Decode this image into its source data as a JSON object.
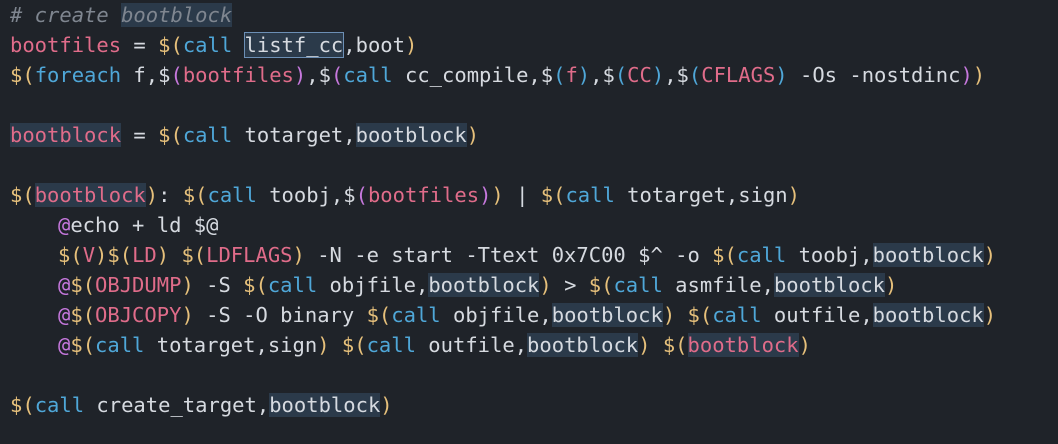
{
  "lines": [
    {
      "id": "l1",
      "tokens": [
        {
          "t": "# create ",
          "c": "comment"
        },
        {
          "t": "bootblock",
          "c": "comment hl"
        }
      ]
    },
    {
      "id": "l2",
      "tokens": [
        {
          "t": "bootfiles",
          "c": "var"
        },
        {
          "t": " = ",
          "c": "op"
        },
        {
          "t": "$",
          "c": "fn"
        },
        {
          "t": "(",
          "c": "fn"
        },
        {
          "t": "call",
          "c": "blue"
        },
        {
          "t": " ",
          "c": "plain"
        },
        {
          "t": "listf_cc",
          "c": "plain hl-sel"
        },
        {
          "t": ",boot",
          "c": "plain"
        },
        {
          "t": ")",
          "c": "fn"
        }
      ]
    },
    {
      "id": "l3",
      "tokens": [
        {
          "t": "$",
          "c": "fn"
        },
        {
          "t": "(",
          "c": "fn"
        },
        {
          "t": "foreach",
          "c": "blue"
        },
        {
          "t": " f,",
          "c": "plain"
        },
        {
          "t": "$",
          "c": "plain"
        },
        {
          "t": "(",
          "c": "purple"
        },
        {
          "t": "bootfiles",
          "c": "var"
        },
        {
          "t": ")",
          "c": "purple"
        },
        {
          "t": ",",
          "c": "plain"
        },
        {
          "t": "$",
          "c": "plain"
        },
        {
          "t": "(",
          "c": "purple"
        },
        {
          "t": "call",
          "c": "blue"
        },
        {
          "t": " cc_compile,",
          "c": "plain"
        },
        {
          "t": "$",
          "c": "plain"
        },
        {
          "t": "(",
          "c": "blue"
        },
        {
          "t": "f",
          "c": "var"
        },
        {
          "t": ")",
          "c": "blue"
        },
        {
          "t": ",",
          "c": "plain"
        },
        {
          "t": "$",
          "c": "plain"
        },
        {
          "t": "(",
          "c": "blue"
        },
        {
          "t": "CC",
          "c": "var"
        },
        {
          "t": ")",
          "c": "blue"
        },
        {
          "t": ",",
          "c": "plain"
        },
        {
          "t": "$",
          "c": "plain"
        },
        {
          "t": "(",
          "c": "blue"
        },
        {
          "t": "CFLAGS",
          "c": "var"
        },
        {
          "t": ")",
          "c": "blue"
        },
        {
          "t": " -Os -nostdinc",
          "c": "plain"
        },
        {
          "t": ")",
          "c": "purple"
        },
        {
          "t": ")",
          "c": "fn"
        }
      ]
    },
    {
      "id": "l4",
      "tokens": []
    },
    {
      "id": "l5",
      "tokens": [
        {
          "t": "bootblock",
          "c": "var hl"
        },
        {
          "t": " = ",
          "c": "op"
        },
        {
          "t": "$",
          "c": "fn"
        },
        {
          "t": "(",
          "c": "fn"
        },
        {
          "t": "call",
          "c": "blue"
        },
        {
          "t": " totarget,",
          "c": "plain"
        },
        {
          "t": "bootblock",
          "c": "plain hl"
        },
        {
          "t": ")",
          "c": "fn"
        }
      ]
    },
    {
      "id": "l6",
      "tokens": []
    },
    {
      "id": "l7",
      "tokens": [
        {
          "t": "$",
          "c": "fn"
        },
        {
          "t": "(",
          "c": "fn"
        },
        {
          "t": "bootblock",
          "c": "var hl"
        },
        {
          "t": ")",
          "c": "fn"
        },
        {
          "t": ": ",
          "c": "plain"
        },
        {
          "t": "$",
          "c": "fn"
        },
        {
          "t": "(",
          "c": "fn"
        },
        {
          "t": "call",
          "c": "blue"
        },
        {
          "t": " toobj,",
          "c": "plain"
        },
        {
          "t": "$",
          "c": "plain"
        },
        {
          "t": "(",
          "c": "purple"
        },
        {
          "t": "bootfiles",
          "c": "var"
        },
        {
          "t": ")",
          "c": "purple"
        },
        {
          "t": ")",
          "c": "fn"
        },
        {
          "t": " | ",
          "c": "plain"
        },
        {
          "t": "$",
          "c": "fn"
        },
        {
          "t": "(",
          "c": "fn"
        },
        {
          "t": "call",
          "c": "blue"
        },
        {
          "t": " totarget,sign",
          "c": "plain"
        },
        {
          "t": ")",
          "c": "fn"
        }
      ]
    },
    {
      "id": "l8",
      "indent": true,
      "tokens": [
        {
          "t": "@",
          "c": "purple"
        },
        {
          "t": "echo + ld $@",
          "c": "plain"
        }
      ]
    },
    {
      "id": "l9",
      "indent": true,
      "tokens": [
        {
          "t": "$",
          "c": "fn"
        },
        {
          "t": "(",
          "c": "fn"
        },
        {
          "t": "V",
          "c": "var"
        },
        {
          "t": ")",
          "c": "fn"
        },
        {
          "t": "$",
          "c": "fn"
        },
        {
          "t": "(",
          "c": "fn"
        },
        {
          "t": "LD",
          "c": "var"
        },
        {
          "t": ")",
          "c": "fn"
        },
        {
          "t": " ",
          "c": "plain"
        },
        {
          "t": "$",
          "c": "fn"
        },
        {
          "t": "(",
          "c": "fn"
        },
        {
          "t": "LDFLAGS",
          "c": "var"
        },
        {
          "t": ")",
          "c": "fn"
        },
        {
          "t": " -N -e start -Ttext 0x7C00 $^ -o ",
          "c": "plain"
        },
        {
          "t": "$",
          "c": "fn"
        },
        {
          "t": "(",
          "c": "fn"
        },
        {
          "t": "call",
          "c": "blue"
        },
        {
          "t": " toobj,",
          "c": "plain"
        },
        {
          "t": "bootblock",
          "c": "plain hl"
        },
        {
          "t": ")",
          "c": "fn"
        }
      ]
    },
    {
      "id": "l10",
      "indent": true,
      "tokens": [
        {
          "t": "@",
          "c": "purple"
        },
        {
          "t": "$",
          "c": "fn"
        },
        {
          "t": "(",
          "c": "fn"
        },
        {
          "t": "OBJDUMP",
          "c": "var"
        },
        {
          "t": ")",
          "c": "fn"
        },
        {
          "t": " -S ",
          "c": "plain"
        },
        {
          "t": "$",
          "c": "fn"
        },
        {
          "t": "(",
          "c": "fn"
        },
        {
          "t": "call",
          "c": "blue"
        },
        {
          "t": " objfile,",
          "c": "plain"
        },
        {
          "t": "bootblock",
          "c": "plain hl"
        },
        {
          "t": ")",
          "c": "fn"
        },
        {
          "t": " > ",
          "c": "plain"
        },
        {
          "t": "$",
          "c": "fn"
        },
        {
          "t": "(",
          "c": "fn"
        },
        {
          "t": "call",
          "c": "blue"
        },
        {
          "t": " asmfile,",
          "c": "plain"
        },
        {
          "t": "bootblock",
          "c": "plain hl"
        },
        {
          "t": ")",
          "c": "fn"
        }
      ]
    },
    {
      "id": "l11",
      "indent": true,
      "tokens": [
        {
          "t": "@",
          "c": "purple"
        },
        {
          "t": "$",
          "c": "fn"
        },
        {
          "t": "(",
          "c": "fn"
        },
        {
          "t": "OBJCOPY",
          "c": "var"
        },
        {
          "t": ")",
          "c": "fn"
        },
        {
          "t": " -S -O binary ",
          "c": "plain"
        },
        {
          "t": "$",
          "c": "fn"
        },
        {
          "t": "(",
          "c": "fn"
        },
        {
          "t": "call",
          "c": "blue"
        },
        {
          "t": " objfile,",
          "c": "plain"
        },
        {
          "t": "bootblock",
          "c": "plain hl"
        },
        {
          "t": ")",
          "c": "fn"
        },
        {
          "t": " ",
          "c": "plain"
        },
        {
          "t": "$",
          "c": "fn"
        },
        {
          "t": "(",
          "c": "fn"
        },
        {
          "t": "call",
          "c": "blue"
        },
        {
          "t": " outfile,",
          "c": "plain"
        },
        {
          "t": "bootblock",
          "c": "plain hl"
        },
        {
          "t": ")",
          "c": "fn"
        }
      ]
    },
    {
      "id": "l12",
      "indent": true,
      "tokens": [
        {
          "t": "@",
          "c": "purple"
        },
        {
          "t": "$",
          "c": "fn"
        },
        {
          "t": "(",
          "c": "fn"
        },
        {
          "t": "call",
          "c": "blue"
        },
        {
          "t": " totarget,sign",
          "c": "plain"
        },
        {
          "t": ")",
          "c": "fn"
        },
        {
          "t": " ",
          "c": "plain"
        },
        {
          "t": "$",
          "c": "fn"
        },
        {
          "t": "(",
          "c": "fn"
        },
        {
          "t": "call",
          "c": "blue"
        },
        {
          "t": " outfile,",
          "c": "plain"
        },
        {
          "t": "bootblock",
          "c": "plain hl"
        },
        {
          "t": ")",
          "c": "fn"
        },
        {
          "t": " ",
          "c": "plain"
        },
        {
          "t": "$",
          "c": "fn"
        },
        {
          "t": "(",
          "c": "fn"
        },
        {
          "t": "bootblock",
          "c": "var hl"
        },
        {
          "t": ")",
          "c": "fn"
        }
      ]
    },
    {
      "id": "l13",
      "tokens": []
    },
    {
      "id": "l14",
      "tokens": [
        {
          "t": "$",
          "c": "fn"
        },
        {
          "t": "(",
          "c": "fn"
        },
        {
          "t": "call",
          "c": "blue"
        },
        {
          "t": " create_target,",
          "c": "plain"
        },
        {
          "t": "bootblock",
          "c": "plain hl"
        },
        {
          "t": ")",
          "c": "fn"
        }
      ]
    }
  ]
}
